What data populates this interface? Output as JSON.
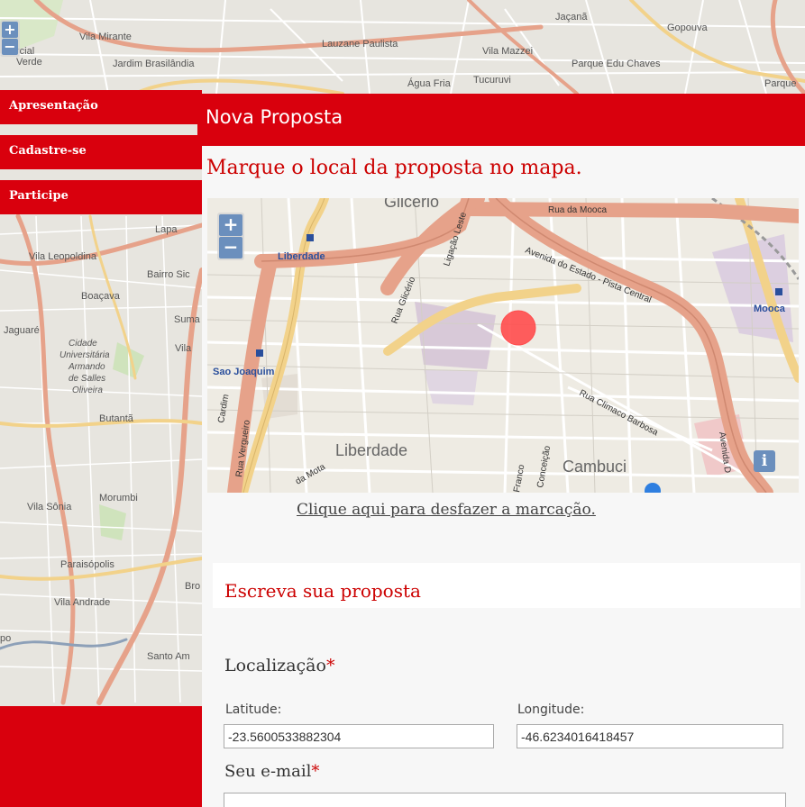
{
  "background_map": {
    "place_labels": [
      "Vila Mirante",
      "Jardim Brasilândia",
      "Lauzane Paulista",
      "Jaçanã",
      "Gopouva",
      "Vila Mazzei",
      "Parque Edu Chaves",
      "Água Fria",
      "Tucuruvi",
      "Parque",
      "Lapa",
      "Vila Leopoldina",
      "Bairro Sic",
      "Boaçava",
      "Suma",
      "Jaguaré",
      "Vila",
      "Butantã",
      "Vila Sônia",
      "Morumbi",
      "Paraisópolis",
      "Vila Andrade",
      "Bro",
      "Santo Am",
      "po"
    ],
    "campus_label": [
      "Cidade",
      "Universitária",
      "Armando",
      "de Salles",
      "Oliveira"
    ],
    "partial_label_lines": [
      "rcial",
      "Verde"
    ],
    "zoom_in": "+",
    "zoom_out": "−"
  },
  "nav": {
    "items": [
      {
        "label": "Apresentação"
      },
      {
        "label": "Cadastre-se"
      },
      {
        "label": "Participe"
      }
    ]
  },
  "panel": {
    "title": "Nova Proposta",
    "map_instruction": "Marque o local da proposta no mapa.",
    "undo_link": "Clique aqui para desfazer a marcação.",
    "section_title": "Escreva sua proposta"
  },
  "proposal_map": {
    "district_labels": [
      "Liberdade",
      "Cambuci"
    ],
    "station_labels": [
      "Liberdade",
      "Sao Joaquim",
      "Mooca"
    ],
    "street_labels": [
      "Rua da Mooca",
      "Avenida do Estado - Pista Central",
      "Rua Glicério",
      "Ligação Leste",
      "Rua Climaco Barbosa",
      "Rua Vergueiro",
      "Cardim",
      "Avenida D",
      "da Mota",
      "Franco",
      "Conceição",
      "Glicerio"
    ],
    "zoom_in": "+",
    "zoom_out": "−",
    "info_button": "i",
    "marker_color": "#ff4d4d"
  },
  "form": {
    "location_label": "Localização",
    "required_mark": "*",
    "latitude_label": "Latitude:",
    "latitude_value": "-23.5600533882304",
    "longitude_label": "Longitude:",
    "longitude_value": "-46.6234016418457",
    "email_label": "Seu e-mail"
  },
  "colors": {
    "brand_red": "#d9000d",
    "title_red": "#cc0000",
    "map_control_blue": "#6b8fbd",
    "road_orange": "#e6a28a",
    "road_yellow": "#f2d28a"
  }
}
